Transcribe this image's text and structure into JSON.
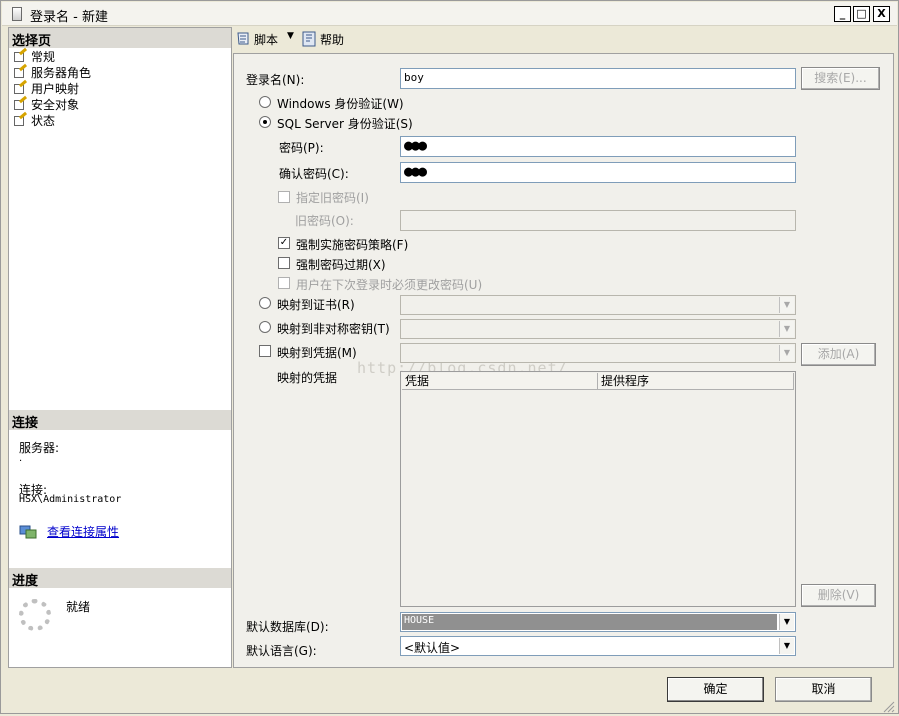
{
  "window": {
    "title": "登录名 - 新建",
    "minimize": "_",
    "maximize": "□",
    "close": "X"
  },
  "left_pane": {
    "select_page_header": "选择页",
    "pages": [
      {
        "label": "常规",
        "icon": "page-icon"
      },
      {
        "label": "服务器角色",
        "icon": "page-icon"
      },
      {
        "label": "用户映射",
        "icon": "page-icon"
      },
      {
        "label": "安全对象",
        "icon": "page-icon"
      },
      {
        "label": "状态",
        "icon": "page-icon"
      }
    ],
    "connection_header": "连接",
    "server_label": "服务器:",
    "server_value": ".",
    "connection_label": "连接:",
    "connection_value": "HSX\\Administrator",
    "view_connection_properties": "查看连接属性",
    "progress_header": "进度",
    "progress_status": "就绪"
  },
  "toolbar": {
    "script_label": "脚本",
    "help_label": "帮助"
  },
  "form": {
    "login_name_label": "登录名(N):",
    "login_name_value": "boy",
    "search_button": "搜索(E)...",
    "windows_auth_label": "Windows 身份验证(W)",
    "sql_auth_label": "SQL Server 身份验证(S)",
    "password_label": "密码(P):",
    "password_value": "●●●",
    "confirm_password_label": "确认密码(C):",
    "confirm_password_value": "●●●",
    "specify_old_password_label": "指定旧密码(I)",
    "old_password_label": "旧密码(O):",
    "enforce_policy_label": "强制实施密码策略(F)",
    "enforce_policy_checked": true,
    "enforce_expiration_label": "强制密码过期(X)",
    "must_change_label": "用户在下次登录时必须更改密码(U)",
    "map_certificate_label": "映射到证书(R)",
    "map_asym_key_label": "映射到非对称密钥(T)",
    "map_credential_label": "映射到凭据(M)",
    "add_button": "添加(A)",
    "mapped_credentials_label": "映射的凭据",
    "grid_columns": [
      "凭据",
      "提供程序"
    ],
    "remove_button": "删除(V)",
    "default_database_label": "默认数据库(D):",
    "default_database_value": "HOUSE",
    "default_language_label": "默认语言(G):",
    "default_language_value": "<默认值>",
    "watermark": "http://blog.csdn.net/"
  },
  "buttons": {
    "ok": "确定",
    "cancel": "取消"
  }
}
